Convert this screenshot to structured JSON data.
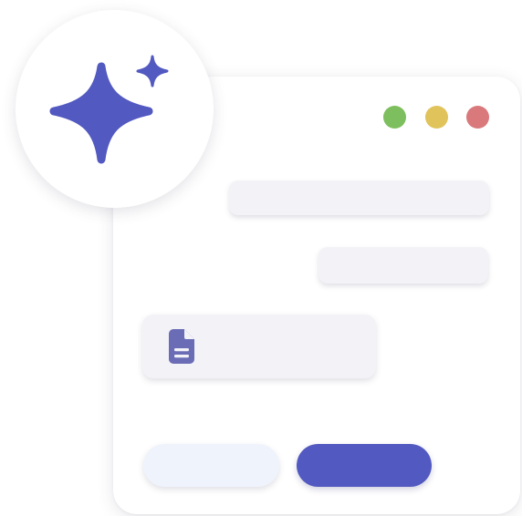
{
  "window": {
    "controls": [
      {
        "name": "green",
        "color": "#7dbf5e"
      },
      {
        "name": "yellow",
        "color": "#e1c35c"
      },
      {
        "name": "red",
        "color": "#d9797c"
      }
    ]
  },
  "attachment": {
    "icon": "document-icon",
    "icon_color": "#6a6db6"
  },
  "actions": {
    "secondary_color": "#eff3fc",
    "primary_color": "#5259c0"
  },
  "ai_badge": {
    "icon": "sparkles-icon",
    "color": "#5259c0"
  }
}
